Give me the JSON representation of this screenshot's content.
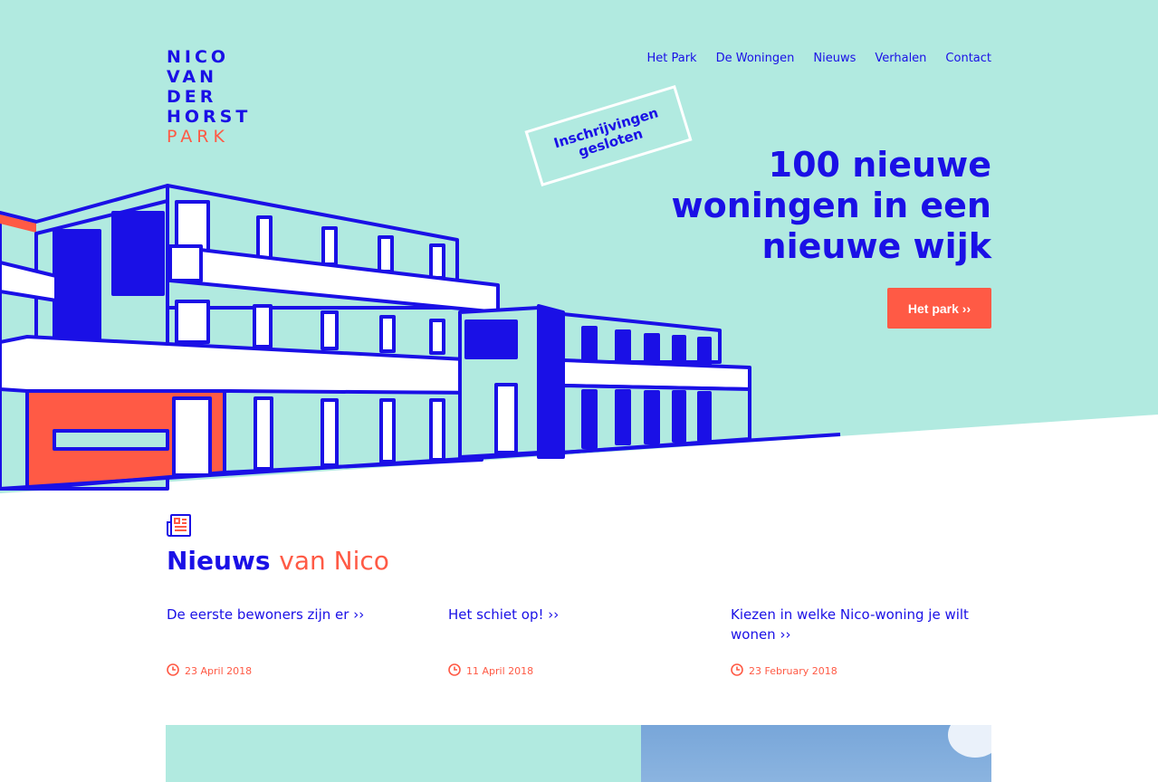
{
  "logo": {
    "line1": "NICO",
    "line2": "VAN",
    "line3": "DER",
    "line4": "HORST",
    "line5": "PARK"
  },
  "nav": {
    "items": [
      "Het Park",
      "De Woningen",
      "Nieuws",
      "Verhalen",
      "Contact"
    ]
  },
  "stamp": {
    "text": "Inschrijvingen gesloten"
  },
  "hero": {
    "line1": "100 nieuwe",
    "line2": "woningen in een",
    "line3": "nieuwe wijk",
    "cta": "Het park ››"
  },
  "news": {
    "title_main": "Nieuws",
    "title_accent": "van Nico",
    "items": [
      {
        "title": "De eerste bewoners zijn er ››",
        "date": "23 April 2018"
      },
      {
        "title": "Het schiet op! ››",
        "date": "11 April 2018"
      },
      {
        "title": "Kiezen in welke Nico-woning je wilt wonen ››",
        "date": "23 February 2018"
      }
    ]
  },
  "colors": {
    "mint": "#b1eae0",
    "blue": "#1a10e6",
    "coral": "#ff5a45"
  },
  "icons": {
    "news": "newspaper-icon",
    "date": "clock-icon"
  }
}
